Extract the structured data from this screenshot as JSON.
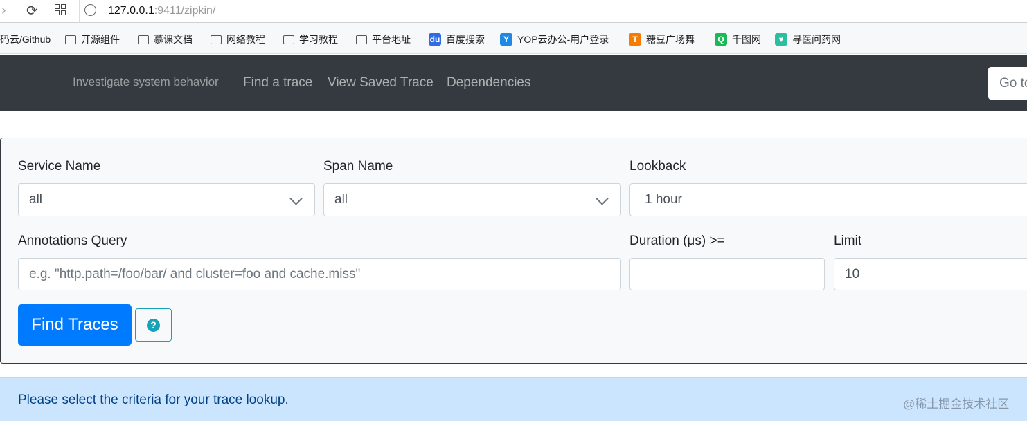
{
  "browser": {
    "url_host": "127.0.0.1",
    "url_rest": ":9411/zipkin/",
    "bookmarks": [
      {
        "label": "码云/Github",
        "icon": "none"
      },
      {
        "label": "开源组件",
        "icon": "folder-icon"
      },
      {
        "label": "慕课文档",
        "icon": "folder-icon"
      },
      {
        "label": "网络教程",
        "icon": "folder-icon"
      },
      {
        "label": "学习教程",
        "icon": "folder-icon"
      },
      {
        "label": "平台地址",
        "icon": "folder-icon"
      },
      {
        "label": "百度搜索",
        "icon": "baidu-icon"
      },
      {
        "label": "YOP云办公-用户登录",
        "icon": "yop-icon"
      },
      {
        "label": "糖豆广场舞",
        "icon": "tangdou-icon"
      },
      {
        "label": "千图网",
        "icon": "qiantu-icon"
      },
      {
        "label": "寻医问药网",
        "icon": "xywy-icon"
      }
    ]
  },
  "navbar": {
    "tagline": "Investigate system behavior",
    "links": [
      "Find a trace",
      "View Saved Trace",
      "Dependencies"
    ],
    "goto_placeholder": "Go to trace"
  },
  "form": {
    "service_name": {
      "label": "Service Name",
      "value": "all"
    },
    "span_name": {
      "label": "Span Name",
      "value": "all"
    },
    "lookback": {
      "label": "Lookback",
      "value": "1 hour"
    },
    "annotations": {
      "label": "Annotations Query",
      "placeholder": "e.g. \"http.path=/foo/bar/ and cluster=foo and cache.miss\""
    },
    "duration": {
      "label": "Duration (μs) >=",
      "value": ""
    },
    "limit": {
      "label": "Limit",
      "value": "10"
    },
    "find_button": "Find Traces",
    "help_icon": "question-circle-icon"
  },
  "alert": "Please select the criteria for your trace lookup.",
  "watermark": "@稀土掘金技术社区",
  "colors": {
    "primary": "#007bff",
    "navbar": "#343a40",
    "info": "#17a2b8",
    "alert_bg": "#cce5ff"
  }
}
